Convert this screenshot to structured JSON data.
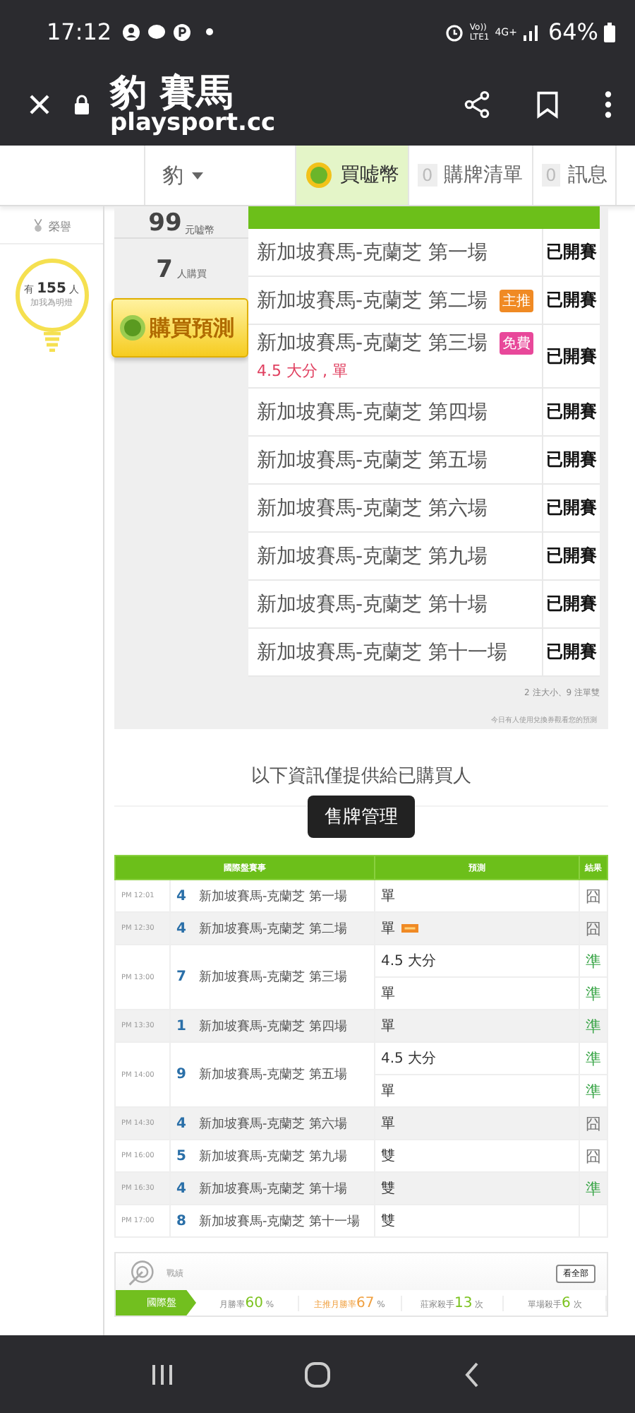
{
  "status_bar": {
    "time": "17:12",
    "volte_top": "Vo))",
    "volte_bottom": "LTE1",
    "network": "4G+",
    "battery": "64%"
  },
  "browser": {
    "title": "豹 賽馬",
    "url": "playsport.cc"
  },
  "nav": {
    "user": "豹",
    "items": [
      {
        "label": "買嘘幣",
        "selected": true
      },
      {
        "count": "0",
        "label": "購牌清單",
        "selected": false
      },
      {
        "count": "0",
        "label": "訊息",
        "selected": false
      }
    ]
  },
  "sidebar": {
    "honor": "榮譽",
    "lamp_prefix": "有",
    "lamp_count": "155",
    "lamp_suffix": "人",
    "lamp_caption": "加我為明燈"
  },
  "card": {
    "coins": "99",
    "coins_unit": "元嘘幣",
    "buyers": "7",
    "buyers_unit": "人購買",
    "buy_button": "購買預測",
    "games": [
      {
        "name": "新加坡賽馬-克蘭芝 第一場",
        "status": "已開賽"
      },
      {
        "name": "新加坡賽馬-克蘭芝 第二場",
        "badge": {
          "kind": "main",
          "text": "主推"
        },
        "status": "已開賽"
      },
      {
        "name": "新加坡賽馬-克蘭芝 第三場",
        "pick": "4.5 大分 , 單",
        "badge": {
          "kind": "free",
          "text": "免費"
        },
        "status": "已開賽"
      },
      {
        "name": "新加坡賽馬-克蘭芝 第四場",
        "status": "已開賽"
      },
      {
        "name": "新加坡賽馬-克蘭芝 第五場",
        "status": "已開賽"
      },
      {
        "name": "新加坡賽馬-克蘭芝 第六場",
        "status": "已開賽"
      },
      {
        "name": "新加坡賽馬-克蘭芝 第九場",
        "status": "已開賽"
      },
      {
        "name": "新加坡賽馬-克蘭芝 第十場",
        "status": "已開賽"
      },
      {
        "name": "新加坡賽馬-克蘭芝 第十一場",
        "status": "已開賽"
      }
    ],
    "summary": "2 注大小、9 注單雙",
    "note": "今日有人使用兌換券觀看您的預測"
  },
  "notice": "以下資訊僅提供給已購買人",
  "manage_button": "售牌管理",
  "table": {
    "columns": [
      "國際盤賽事",
      "預測",
      "結果"
    ],
    "rows": [
      {
        "time": "PM 12:01",
        "number": "4",
        "name": "新加坡賽馬-克蘭芝 第一場",
        "picks": [
          {
            "text": "單",
            "result": "囧",
            "hit": false
          }
        ]
      },
      {
        "time": "PM 12:30",
        "number": "4",
        "name": "新加坡賽馬-克蘭芝 第二場",
        "picks": [
          {
            "text": "單",
            "main": true,
            "result": "囧",
            "hit": false
          }
        ]
      },
      {
        "time": "PM 13:00",
        "number": "7",
        "name": "新加坡賽馬-克蘭芝 第三場",
        "picks": [
          {
            "text": "4.5 大分",
            "result": "準",
            "hit": true
          },
          {
            "text": "單",
            "result": "準",
            "hit": true
          }
        ]
      },
      {
        "time": "PM 13:30",
        "number": "1",
        "name": "新加坡賽馬-克蘭芝 第四場",
        "picks": [
          {
            "text": "單",
            "result": "準",
            "hit": true
          }
        ]
      },
      {
        "time": "PM 14:00",
        "number": "9",
        "name": "新加坡賽馬-克蘭芝 第五場",
        "picks": [
          {
            "text": "4.5 大分",
            "result": "準",
            "hit": true
          },
          {
            "text": "單",
            "result": "準",
            "hit": true
          }
        ]
      },
      {
        "time": "PM 14:30",
        "number": "4",
        "name": "新加坡賽馬-克蘭芝 第六場",
        "picks": [
          {
            "text": "單",
            "result": "囧",
            "hit": false
          }
        ]
      },
      {
        "time": "PM 16:00",
        "number": "5",
        "name": "新加坡賽馬-克蘭芝 第九場",
        "picks": [
          {
            "text": "雙",
            "result": "囧",
            "hit": false
          }
        ]
      },
      {
        "time": "PM 16:30",
        "number": "4",
        "name": "新加坡賽馬-克蘭芝 第十場",
        "picks": [
          {
            "text": "雙",
            "result": "準",
            "hit": true
          }
        ]
      },
      {
        "time": "PM 17:00",
        "number": "8",
        "name": "新加坡賽馬-克蘭芝 第十一場",
        "picks": [
          {
            "text": "雙"
          }
        ]
      }
    ]
  },
  "record": {
    "title": "戰績",
    "more_button": "看全部",
    "tab": "國際盤",
    "stats": [
      {
        "label": "月勝率",
        "value": "60",
        "unit": "%",
        "color": "#7cc21f"
      },
      {
        "label": "主推月勝率",
        "value": "67",
        "unit": "%",
        "color": "#f0a040"
      },
      {
        "label": "莊家殺手",
        "value": "13",
        "unit": "次",
        "color": "#7cc21f"
      },
      {
        "label": "單場殺手",
        "value": "6",
        "unit": "次",
        "color": "#7cc21f"
      }
    ]
  }
}
